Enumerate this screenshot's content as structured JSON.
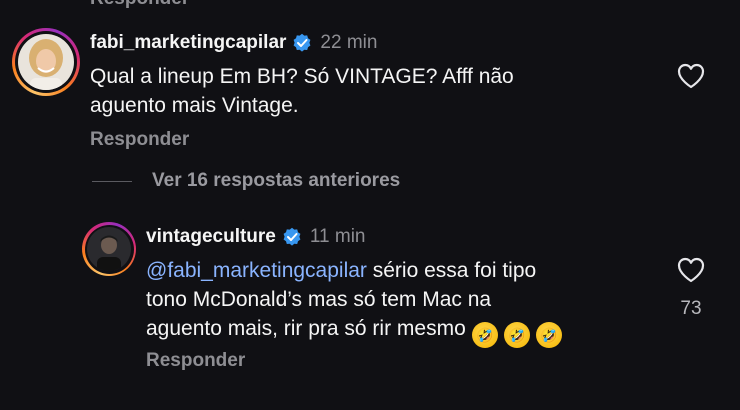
{
  "top_partial": {
    "label": "Responder"
  },
  "comment1": {
    "username": "fabi_marketingcapilar",
    "time": "22 min",
    "text": "Qual a lineup Em BH?  Só VINTAGE? Afff  não aguento mais Vintage.",
    "line1": "Qual a lineup Em BH?  Só VINTAGE? Afff  não",
    "line2": "aguento mais Vintage.",
    "reply_label": "Responder"
  },
  "view_replies": {
    "label": "Ver 16 respostas anteriores"
  },
  "comment2": {
    "username": "vintageculture",
    "time": "11 min",
    "mention": "@fabi_marketingcapilar",
    "line1_rest": " sério essa foi tipo",
    "line2": "tono McDonald’s mas só tem Mac na",
    "line3": "aguento mais, rir pra só rir mesmo",
    "emojis": [
      "rolling-on-floor-laughing",
      "rolling-on-floor-laughing",
      "rolling-on-floor-laughing"
    ],
    "likes": "73",
    "reply_label": "Responder"
  },
  "colors": {
    "background": "#101014",
    "mention": "#8ab4ff",
    "verified": "#3897f0",
    "muted": "#8e8e93"
  }
}
